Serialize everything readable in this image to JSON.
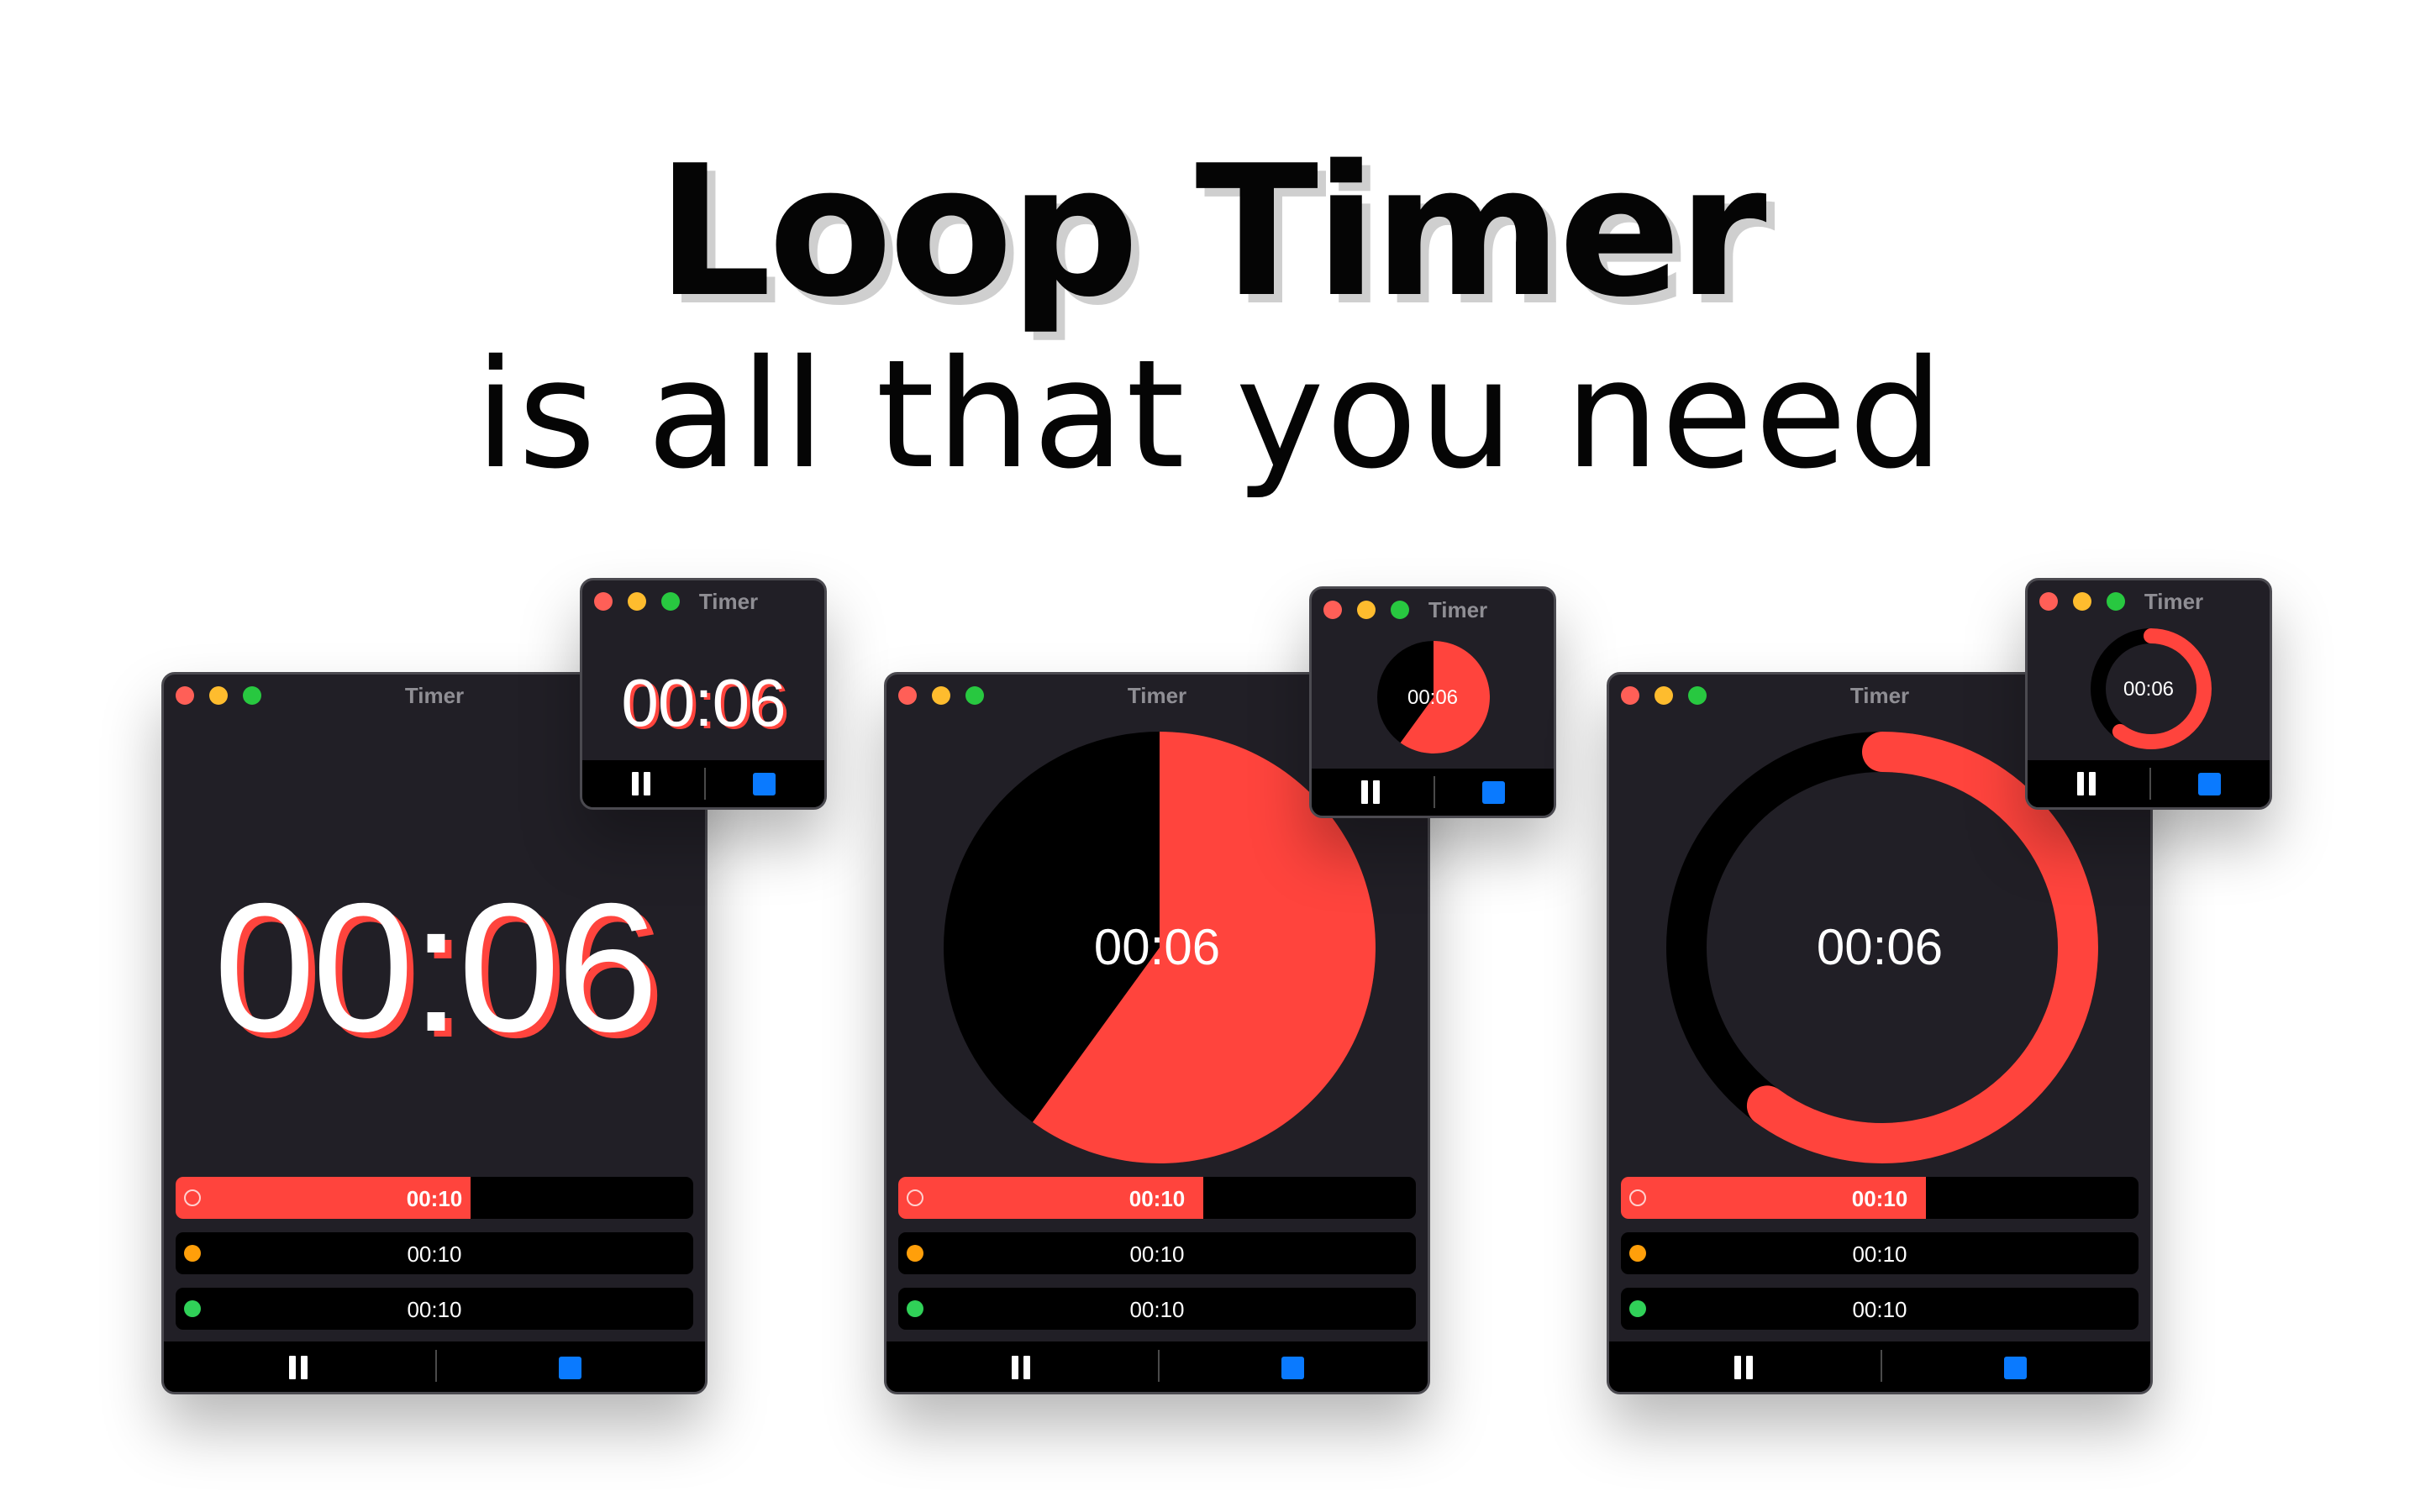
{
  "headline": {
    "title": "Loop Timer",
    "subtitle": "is all that you need"
  },
  "colors": {
    "accent": "#ff443d",
    "window_bg": "#211f26",
    "track": "#000000",
    "stop_button": "#0a7aff",
    "dot_orange": "#ff9f0a",
    "dot_green": "#30d158"
  },
  "windows": [
    {
      "style": "digital",
      "title": "Timer",
      "display": "00:06",
      "intervals": [
        {
          "time": "00:10",
          "dot": "outline",
          "progress": 0.57,
          "active": true
        },
        {
          "time": "00:10",
          "dot": "orange",
          "progress": 0,
          "active": false
        },
        {
          "time": "00:10",
          "dot": "green",
          "progress": 0,
          "active": false
        }
      ],
      "controls": {
        "pause_icon": "pause-icon",
        "stop_icon": "stop-icon"
      },
      "mini": {
        "title": "Timer",
        "display": "00:06"
      }
    },
    {
      "style": "pie",
      "title": "Timer",
      "display": "00:06",
      "remaining_fraction": 0.6,
      "intervals": [
        {
          "time": "00:10",
          "dot": "outline",
          "progress": 0.59,
          "active": true
        },
        {
          "time": "00:10",
          "dot": "orange",
          "progress": 0,
          "active": false
        },
        {
          "time": "00:10",
          "dot": "green",
          "progress": 0,
          "active": false
        }
      ],
      "controls": {
        "pause_icon": "pause-icon",
        "stop_icon": "stop-icon"
      },
      "mini": {
        "title": "Timer",
        "display": "00:06"
      }
    },
    {
      "style": "ring",
      "title": "Timer",
      "display": "00:06",
      "remaining_fraction": 0.6,
      "intervals": [
        {
          "time": "00:10",
          "dot": "outline",
          "progress": 0.59,
          "active": true
        },
        {
          "time": "00:10",
          "dot": "orange",
          "progress": 0,
          "active": false
        },
        {
          "time": "00:10",
          "dot": "green",
          "progress": 0,
          "active": false
        }
      ],
      "controls": {
        "pause_icon": "pause-icon",
        "stop_icon": "stop-icon"
      },
      "mini": {
        "title": "Timer",
        "display": "00:06"
      }
    }
  ]
}
